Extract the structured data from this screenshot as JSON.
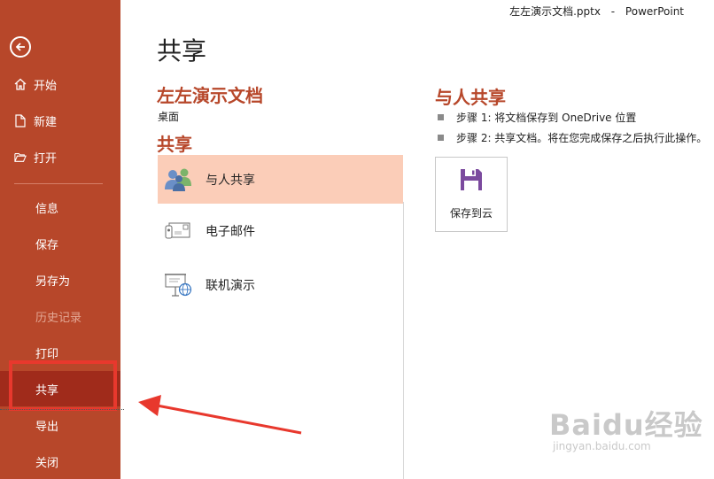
{
  "window": {
    "filename": "左左演示文档.pptx",
    "separator": "-",
    "app_name": "PowerPoint"
  },
  "sidebar": {
    "back_icon": "back-arrow-icon",
    "items": [
      {
        "label": "开始",
        "icon": "home-icon"
      },
      {
        "label": "新建",
        "icon": "new-file-icon"
      },
      {
        "label": "打开",
        "icon": "open-folder-icon"
      },
      {
        "label": "信息"
      },
      {
        "label": "保存"
      },
      {
        "label": "另存为"
      },
      {
        "label": "历史记录",
        "disabled": true
      },
      {
        "label": "打印"
      },
      {
        "label": "共享",
        "active": true
      },
      {
        "label": "导出"
      },
      {
        "label": "关闭"
      }
    ],
    "colors": {
      "background": "#b7472a",
      "active": "#a02b1b"
    }
  },
  "main": {
    "title": "共享",
    "document_name": "左左演示文档",
    "document_location": "桌面",
    "share_heading": "共享",
    "share_options": [
      {
        "label": "与人共享",
        "icon": "share-with-people-icon",
        "selected": true
      },
      {
        "label": "电子邮件",
        "icon": "email-icon"
      },
      {
        "label": "联机演示",
        "icon": "present-online-icon"
      }
    ]
  },
  "detail": {
    "heading": "与人共享",
    "steps": [
      "步骤 1: 将文档保存到 OneDrive 位置",
      "步骤 2: 共享文档。将在您完成保存之后执行此操作。"
    ],
    "save_to_cloud_label": "保存到云",
    "save_to_cloud_icon": "floppy-disk-icon"
  },
  "annotation": {
    "highlight_color": "#e8382d"
  },
  "watermark": {
    "logo": "Baidu经验",
    "url": "jingyan.baidu.com"
  }
}
